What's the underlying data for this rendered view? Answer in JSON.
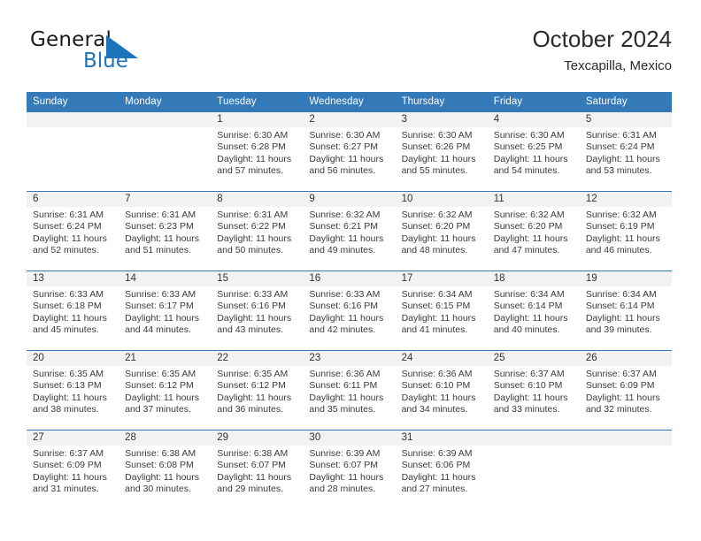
{
  "brand": {
    "name_part1": "General",
    "name_part2": "Blue",
    "accent_color": "#1e74bb",
    "flag_icon": "blue-triangle-flag-icon"
  },
  "header": {
    "title": "October 2024",
    "subtitle": "Texcapilla, Mexico"
  },
  "calendar": {
    "header_bg": "#3479b8",
    "daynum_bg": "#f2f2f2",
    "weekdays": [
      "Sunday",
      "Monday",
      "Tuesday",
      "Wednesday",
      "Thursday",
      "Friday",
      "Saturday"
    ],
    "weeks": [
      [
        {
          "day": "",
          "empty": true
        },
        {
          "day": "",
          "empty": true
        },
        {
          "day": "1",
          "sunrise": "Sunrise: 6:30 AM",
          "sunset": "Sunset: 6:28 PM",
          "daylight_line1": "Daylight: 11 hours",
          "daylight_line2": "and 57 minutes."
        },
        {
          "day": "2",
          "sunrise": "Sunrise: 6:30 AM",
          "sunset": "Sunset: 6:27 PM",
          "daylight_line1": "Daylight: 11 hours",
          "daylight_line2": "and 56 minutes."
        },
        {
          "day": "3",
          "sunrise": "Sunrise: 6:30 AM",
          "sunset": "Sunset: 6:26 PM",
          "daylight_line1": "Daylight: 11 hours",
          "daylight_line2": "and 55 minutes."
        },
        {
          "day": "4",
          "sunrise": "Sunrise: 6:30 AM",
          "sunset": "Sunset: 6:25 PM",
          "daylight_line1": "Daylight: 11 hours",
          "daylight_line2": "and 54 minutes."
        },
        {
          "day": "5",
          "sunrise": "Sunrise: 6:31 AM",
          "sunset": "Sunset: 6:24 PM",
          "daylight_line1": "Daylight: 11 hours",
          "daylight_line2": "and 53 minutes."
        }
      ],
      [
        {
          "day": "6",
          "sunrise": "Sunrise: 6:31 AM",
          "sunset": "Sunset: 6:24 PM",
          "daylight_line1": "Daylight: 11 hours",
          "daylight_line2": "and 52 minutes."
        },
        {
          "day": "7",
          "sunrise": "Sunrise: 6:31 AM",
          "sunset": "Sunset: 6:23 PM",
          "daylight_line1": "Daylight: 11 hours",
          "daylight_line2": "and 51 minutes."
        },
        {
          "day": "8",
          "sunrise": "Sunrise: 6:31 AM",
          "sunset": "Sunset: 6:22 PM",
          "daylight_line1": "Daylight: 11 hours",
          "daylight_line2": "and 50 minutes."
        },
        {
          "day": "9",
          "sunrise": "Sunrise: 6:32 AM",
          "sunset": "Sunset: 6:21 PM",
          "daylight_line1": "Daylight: 11 hours",
          "daylight_line2": "and 49 minutes."
        },
        {
          "day": "10",
          "sunrise": "Sunrise: 6:32 AM",
          "sunset": "Sunset: 6:20 PM",
          "daylight_line1": "Daylight: 11 hours",
          "daylight_line2": "and 48 minutes."
        },
        {
          "day": "11",
          "sunrise": "Sunrise: 6:32 AM",
          "sunset": "Sunset: 6:20 PM",
          "daylight_line1": "Daylight: 11 hours",
          "daylight_line2": "and 47 minutes."
        },
        {
          "day": "12",
          "sunrise": "Sunrise: 6:32 AM",
          "sunset": "Sunset: 6:19 PM",
          "daylight_line1": "Daylight: 11 hours",
          "daylight_line2": "and 46 minutes."
        }
      ],
      [
        {
          "day": "13",
          "sunrise": "Sunrise: 6:33 AM",
          "sunset": "Sunset: 6:18 PM",
          "daylight_line1": "Daylight: 11 hours",
          "daylight_line2": "and 45 minutes."
        },
        {
          "day": "14",
          "sunrise": "Sunrise: 6:33 AM",
          "sunset": "Sunset: 6:17 PM",
          "daylight_line1": "Daylight: 11 hours",
          "daylight_line2": "and 44 minutes."
        },
        {
          "day": "15",
          "sunrise": "Sunrise: 6:33 AM",
          "sunset": "Sunset: 6:16 PM",
          "daylight_line1": "Daylight: 11 hours",
          "daylight_line2": "and 43 minutes."
        },
        {
          "day": "16",
          "sunrise": "Sunrise: 6:33 AM",
          "sunset": "Sunset: 6:16 PM",
          "daylight_line1": "Daylight: 11 hours",
          "daylight_line2": "and 42 minutes."
        },
        {
          "day": "17",
          "sunrise": "Sunrise: 6:34 AM",
          "sunset": "Sunset: 6:15 PM",
          "daylight_line1": "Daylight: 11 hours",
          "daylight_line2": "and 41 minutes."
        },
        {
          "day": "18",
          "sunrise": "Sunrise: 6:34 AM",
          "sunset": "Sunset: 6:14 PM",
          "daylight_line1": "Daylight: 11 hours",
          "daylight_line2": "and 40 minutes."
        },
        {
          "day": "19",
          "sunrise": "Sunrise: 6:34 AM",
          "sunset": "Sunset: 6:14 PM",
          "daylight_line1": "Daylight: 11 hours",
          "daylight_line2": "and 39 minutes."
        }
      ],
      [
        {
          "day": "20",
          "sunrise": "Sunrise: 6:35 AM",
          "sunset": "Sunset: 6:13 PM",
          "daylight_line1": "Daylight: 11 hours",
          "daylight_line2": "and 38 minutes."
        },
        {
          "day": "21",
          "sunrise": "Sunrise: 6:35 AM",
          "sunset": "Sunset: 6:12 PM",
          "daylight_line1": "Daylight: 11 hours",
          "daylight_line2": "and 37 minutes."
        },
        {
          "day": "22",
          "sunrise": "Sunrise: 6:35 AM",
          "sunset": "Sunset: 6:12 PM",
          "daylight_line1": "Daylight: 11 hours",
          "daylight_line2": "and 36 minutes."
        },
        {
          "day": "23",
          "sunrise": "Sunrise: 6:36 AM",
          "sunset": "Sunset: 6:11 PM",
          "daylight_line1": "Daylight: 11 hours",
          "daylight_line2": "and 35 minutes."
        },
        {
          "day": "24",
          "sunrise": "Sunrise: 6:36 AM",
          "sunset": "Sunset: 6:10 PM",
          "daylight_line1": "Daylight: 11 hours",
          "daylight_line2": "and 34 minutes."
        },
        {
          "day": "25",
          "sunrise": "Sunrise: 6:37 AM",
          "sunset": "Sunset: 6:10 PM",
          "daylight_line1": "Daylight: 11 hours",
          "daylight_line2": "and 33 minutes."
        },
        {
          "day": "26",
          "sunrise": "Sunrise: 6:37 AM",
          "sunset": "Sunset: 6:09 PM",
          "daylight_line1": "Daylight: 11 hours",
          "daylight_line2": "and 32 minutes."
        }
      ],
      [
        {
          "day": "27",
          "sunrise": "Sunrise: 6:37 AM",
          "sunset": "Sunset: 6:09 PM",
          "daylight_line1": "Daylight: 11 hours",
          "daylight_line2": "and 31 minutes."
        },
        {
          "day": "28",
          "sunrise": "Sunrise: 6:38 AM",
          "sunset": "Sunset: 6:08 PM",
          "daylight_line1": "Daylight: 11 hours",
          "daylight_line2": "and 30 minutes."
        },
        {
          "day": "29",
          "sunrise": "Sunrise: 6:38 AM",
          "sunset": "Sunset: 6:07 PM",
          "daylight_line1": "Daylight: 11 hours",
          "daylight_line2": "and 29 minutes."
        },
        {
          "day": "30",
          "sunrise": "Sunrise: 6:39 AM",
          "sunset": "Sunset: 6:07 PM",
          "daylight_line1": "Daylight: 11 hours",
          "daylight_line2": "and 28 minutes."
        },
        {
          "day": "31",
          "sunrise": "Sunrise: 6:39 AM",
          "sunset": "Sunset: 6:06 PM",
          "daylight_line1": "Daylight: 11 hours",
          "daylight_line2": "and 27 minutes."
        },
        {
          "day": "",
          "empty": true
        },
        {
          "day": "",
          "empty": true
        }
      ]
    ]
  }
}
